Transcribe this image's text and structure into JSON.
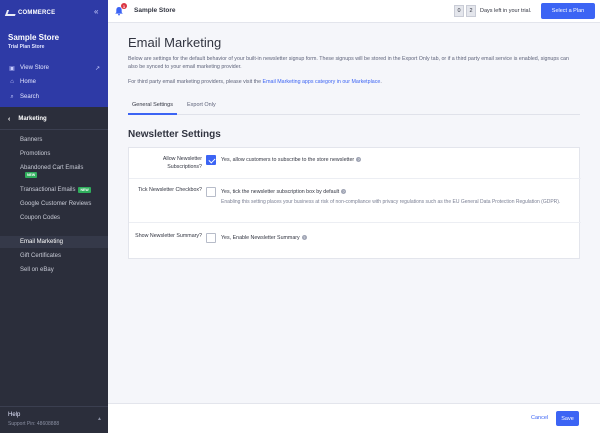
{
  "sidebar": {
    "logo_text": "COMMERCE",
    "store_name": "Sample Store",
    "store_plan": "Trial Plan Store",
    "links": [
      {
        "label": "View Store"
      },
      {
        "label": "Home"
      },
      {
        "label": "Search"
      }
    ],
    "section": "Marketing",
    "items": [
      {
        "label": "Banners"
      },
      {
        "label": "Promotions"
      },
      {
        "label": "Abandoned Cart Emails",
        "badge": "NEW"
      },
      {
        "label": "Transactional Emails",
        "badge": "NEW"
      },
      {
        "label": "Google Customer Reviews"
      },
      {
        "label": "Coupon Codes"
      },
      {
        "label": "Email Marketing"
      },
      {
        "label": "Gift Certificates"
      },
      {
        "label": "Sell on eBay"
      }
    ],
    "help": "Help",
    "support_pin": "Support Pin: 48608888"
  },
  "topbar": {
    "notification_count": "1",
    "store_name": "Sample Store",
    "trial_digits": [
      "0",
      "2"
    ],
    "trial_text": "Days left in your trial.",
    "plan_button": "Select a Plan"
  },
  "main": {
    "title": "Email Marketing",
    "desc1": "Below are settings for the default behavior of your built-in newsletter signup form. These signups will be stored in the Export Only tab, or if a third party email service is enabled, signups can also be synced to your email marketing provider.",
    "desc2_prefix": "For third party email marketing providers, please visit the ",
    "desc2_link": "Email Marketing apps category in our Marketplace",
    "desc2_suffix": ".",
    "tabs": [
      {
        "label": "General Settings"
      },
      {
        "label": "Export Only"
      }
    ],
    "section_title": "Newsletter Settings",
    "settings": [
      {
        "label": "Allow Newsletter Subscriptions?",
        "option": "Yes, allow customers to subscribe to the store newsletter",
        "checked": true
      },
      {
        "label": "Tick Newsletter Checkbox?",
        "option": "Yes, tick the newsletter subscription box by default",
        "help": "Enabling this setting places your business at risk of non-compliance with privacy regulations such as the EU General Data Protection Regulation (GDPR).",
        "checked": false
      },
      {
        "label": "Show Newsletter Summary?",
        "option": "Yes, Enable Newsletter Summary",
        "checked": false
      }
    ]
  },
  "footer": {
    "cancel": "Cancel",
    "save": "Save"
  },
  "colors": {
    "brand": "#2e3aa6",
    "accent": "#3c64f4",
    "sidebar_bg": "#2b2e3b",
    "badge_new": "#2fae5c"
  }
}
